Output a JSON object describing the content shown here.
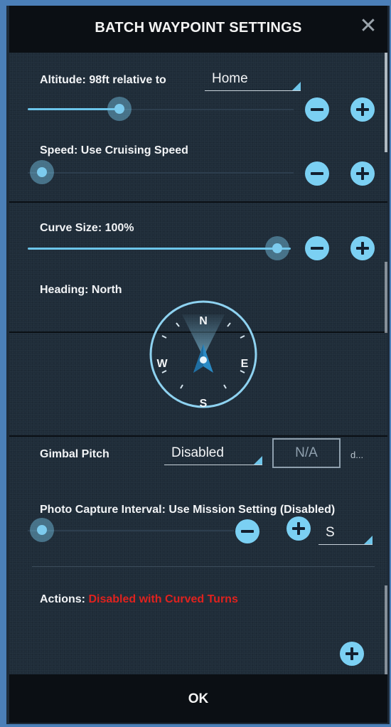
{
  "header": {
    "title": "BATCH WAYPOINT SETTINGS",
    "close_icon": "close-icon"
  },
  "altitude": {
    "label": "Altitude: 98ft  relative to",
    "reference_value": "Home",
    "slider_level": 0.25
  },
  "speed": {
    "label": "Speed: Use Cruising Speed",
    "slider_level": 0.0
  },
  "curve": {
    "label": "Curve Size: 100%",
    "slider_level": 1.0
  },
  "heading": {
    "label": "Heading: North",
    "compass": {
      "n": "N",
      "e": "E",
      "s": "S",
      "w": "W"
    }
  },
  "gimbal": {
    "label": "Gimbal Pitch",
    "mode_value": "Disabled",
    "value_box": "N/A",
    "unit": "d..."
  },
  "photo": {
    "label": "Photo Capture Interval: Use Mission Setting (Disabled)",
    "slider_level": 0.0,
    "unit_value": "S"
  },
  "actions": {
    "label": "Actions:",
    "status": "Disabled with Curved Turns"
  },
  "footer": {
    "ok_label": "OK"
  },
  "colors": {
    "accent": "#7bd0f3",
    "status_red": "#e0221e",
    "header_bg": "#0b0f14"
  }
}
